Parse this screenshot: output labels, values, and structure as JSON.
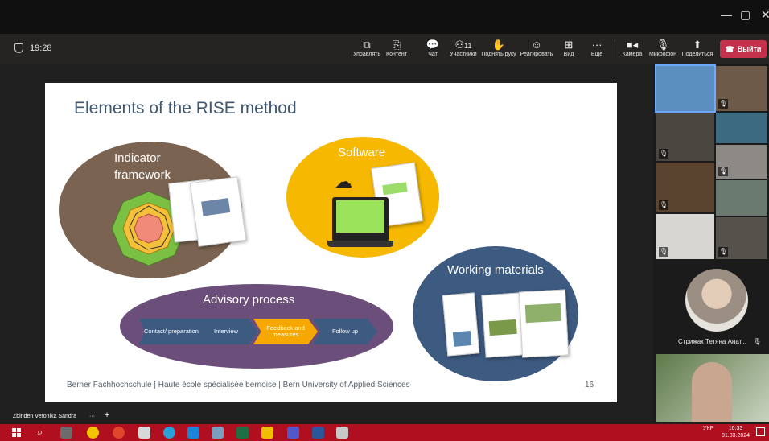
{
  "window": {
    "minimize_glyph": "—",
    "restore_glyph": "▢",
    "close_glyph": "✕"
  },
  "meeting": {
    "elapsed": "19:28"
  },
  "toolbar": {
    "share": "Управлять",
    "content": "Контент",
    "chat": "Чат",
    "participants": "Участники",
    "participants_count": "11",
    "raise_hand": "Поднять руку",
    "react": "Реагировать",
    "view": "Вид",
    "more": "Еще",
    "camera": "Камера",
    "mic": "Микрофон",
    "share_screen": "Поделиться",
    "leave": "Выйти"
  },
  "slide": {
    "title": "Elements of the RISE method",
    "indicator_label_1": "Indicator",
    "indicator_label_2": "framework",
    "software_label": "Software",
    "working_label": "Working materials",
    "advisory_label": "Advisory process",
    "steps": [
      "Contact/ preparation",
      "Interview",
      "Feedback and measures",
      "Follow up"
    ],
    "footer": "Berner Fachhochschule | Haute école spécialisée bernoise | Bern University of Applied Sciences",
    "page_number": "16"
  },
  "participants": {
    "spotlight_name": "Стрижак Тетяна Анат...",
    "presenter_name": "Zbinden Veronika Sandra",
    "add_glyph": "+",
    "presenter_more": "···"
  },
  "taskbar": {
    "search_glyph": "⌕",
    "language": "УКР",
    "time": "10:33",
    "date": "01.03.2024"
  },
  "colors": {
    "brown": "#7a6350",
    "yellow": "#f6b800",
    "purple": "#6b4f7a",
    "slate": "#3d5a80",
    "leave_red": "#c4314b",
    "taskbar_red": "#b00f1f"
  }
}
